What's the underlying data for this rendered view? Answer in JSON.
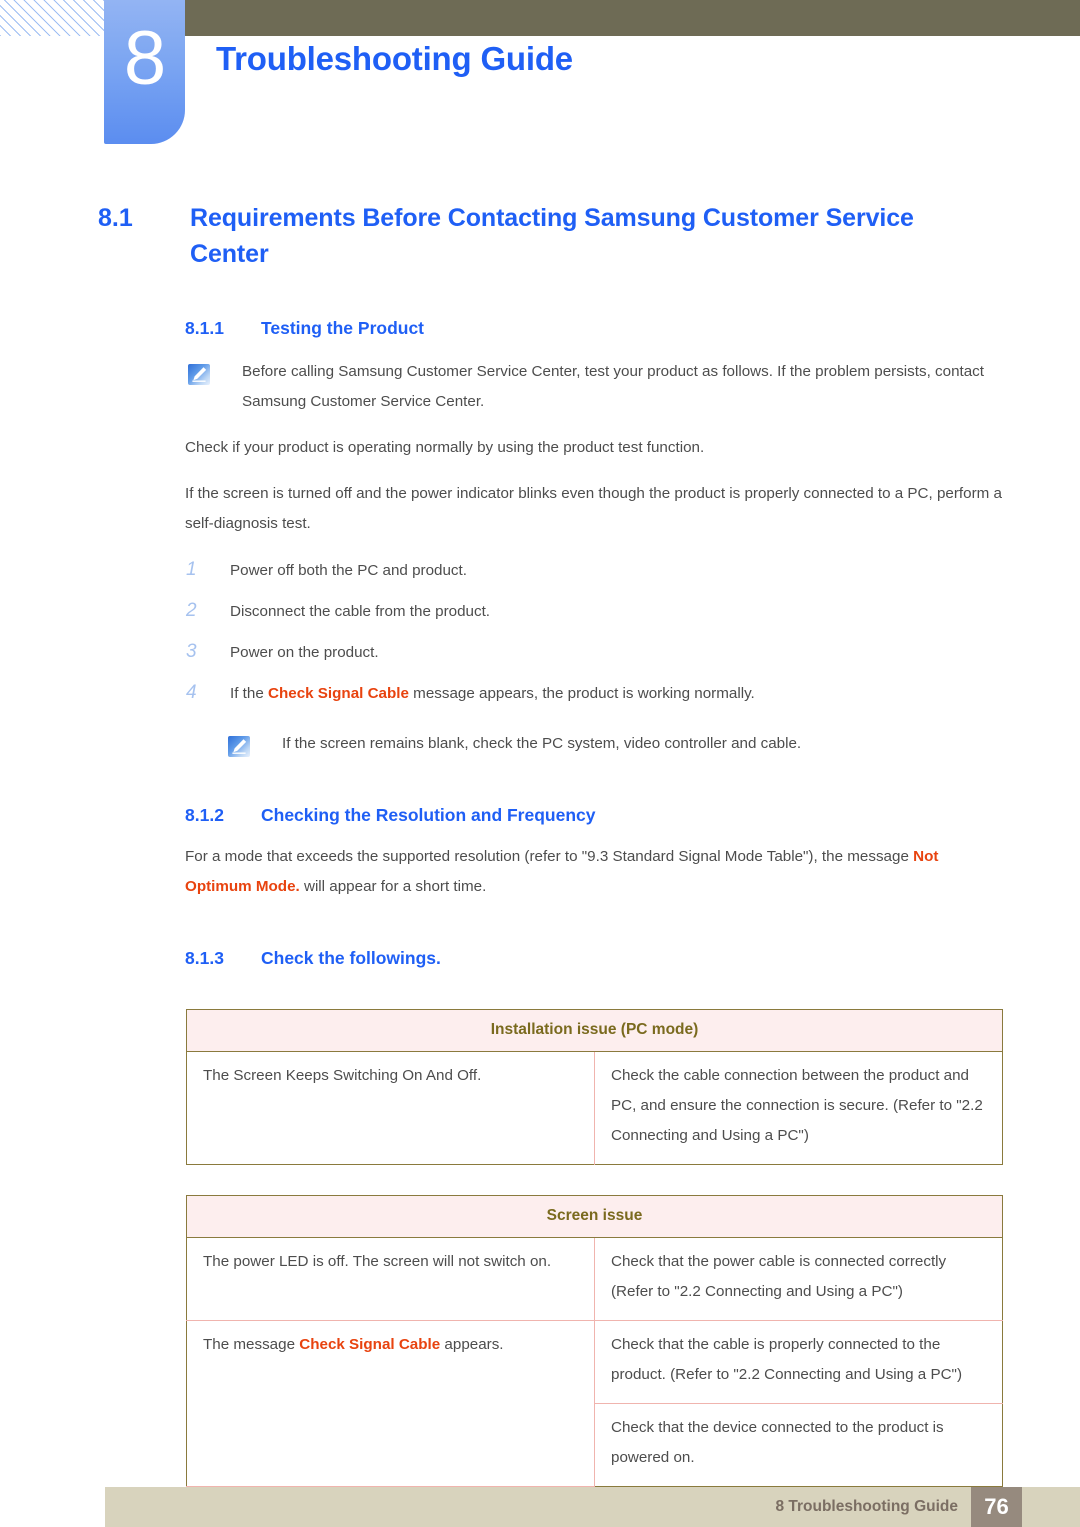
{
  "header": {
    "chapter_number": "8",
    "chapter_title": "Troubleshooting Guide",
    "accent_blue": "#1f5ff5",
    "tab_blue": "#7ba5f2",
    "olive_bar": "#6e6b55"
  },
  "section": {
    "number": "8.1",
    "title": "Requirements Before Contacting Samsung Customer Service Center"
  },
  "sub1": {
    "number": "8.1.1",
    "title": "Testing the Product",
    "note1": "Before calling Samsung Customer Service Center, test your product as follows. If the problem persists, contact Samsung Customer Service Center.",
    "para1": "Check if your product is operating normally by using the product test function.",
    "para2": "If the screen is turned off and the power indicator blinks even though the product is properly connected to a PC, perform a self-diagnosis test.",
    "steps": [
      {
        "num": "1",
        "text": "Power off both the PC and product."
      },
      {
        "num": "2",
        "text": "Disconnect the cable from the product."
      },
      {
        "num": "3",
        "text": "Power on the product."
      },
      {
        "num": "4",
        "text_before": "If the ",
        "highlight": "Check Signal Cable",
        "text_after": " message appears, the product is working normally."
      }
    ],
    "note2": "If the screen remains blank, check the PC system, video controller and cable."
  },
  "sub2": {
    "number": "8.1.2",
    "title": "Checking the Resolution and Frequency",
    "para_before": "For a mode that exceeds the supported resolution (refer to \"9.3 Standard Signal Mode Table\"), the message ",
    "para_highlight": "Not Optimum Mode.",
    "para_after": " will appear for a short time."
  },
  "sub3": {
    "number": "8.1.3",
    "title": "Check the followings."
  },
  "table1": {
    "header": "Installation issue (PC mode)",
    "rows": [
      {
        "symptom": "The Screen Keeps Switching On And Off.",
        "solution": "Check the cable connection between the product and PC, and ensure the connection is secure. (Refer to \"2.2 Connecting and Using a PC\")"
      }
    ]
  },
  "table2": {
    "header": "Screen issue",
    "rows": [
      {
        "symptom": "The power LED is off. The screen will not switch on.",
        "solution": "Check that the power cable is connected correctly (Refer to \"2.2 Connecting and Using a PC\")"
      },
      {
        "symptom_before": "The message ",
        "symptom_highlight": "Check Signal Cable",
        "symptom_after": " appears.",
        "solution": "Check that the cable is properly connected to the product. (Refer to \"2.2 Connecting and Using a PC\")"
      },
      {
        "solution": "Check that the device connected to the product is powered on."
      }
    ]
  },
  "footer": {
    "text": "8 Troubleshooting Guide",
    "page": "76",
    "bar_color": "#d8d3bd",
    "page_box_color": "#968a7e"
  },
  "colors": {
    "highlight_red": "#e8430f",
    "table_border": "#8a7a3d",
    "table_header_bg": "#fdeeee",
    "table_header_text": "#7a6a1e",
    "table_inner_border": "#f0b4ae"
  }
}
